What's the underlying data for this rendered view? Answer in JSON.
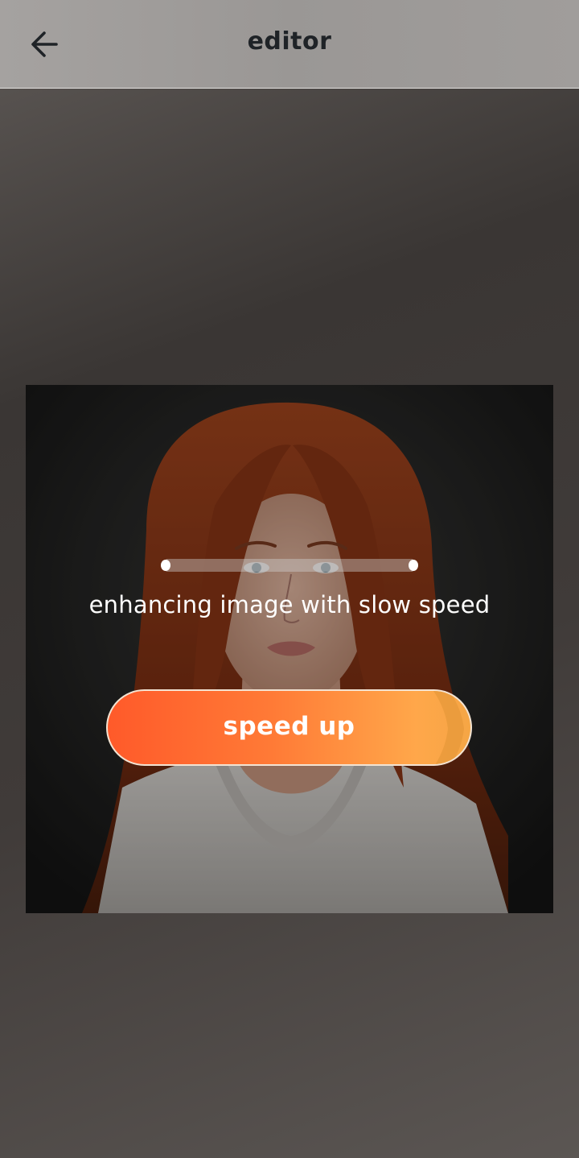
{
  "header": {
    "title": "editor",
    "back_icon": "arrow-left-icon"
  },
  "image": {
    "description_icon": "portrait-photo",
    "overlay": {
      "progress": 0.0,
      "status_text": "enhancing image with slow speed",
      "speed_button_label": "speed up"
    }
  },
  "colors": {
    "header_bg": "#a09d9b",
    "title_color": "#1f2327",
    "button_gradient_start": "#ff5a2a",
    "button_gradient_end": "#ffa74a"
  }
}
